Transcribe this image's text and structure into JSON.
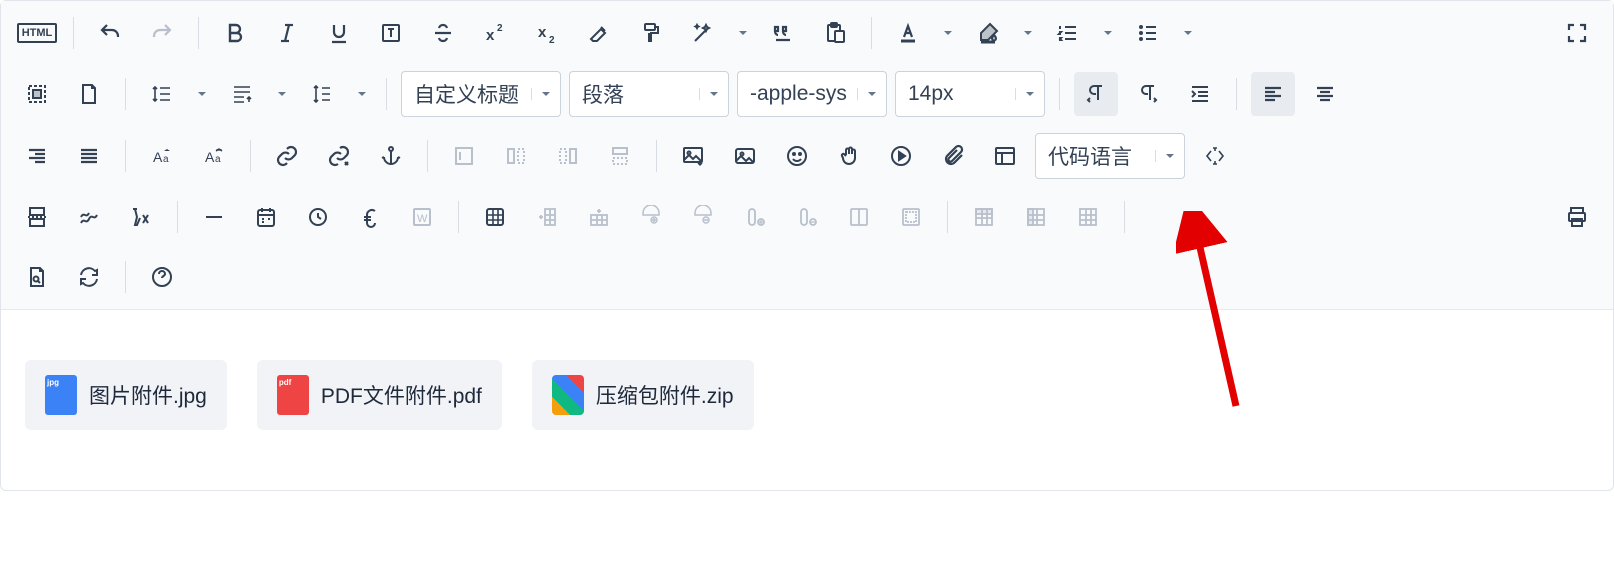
{
  "toolbar": {
    "html_label": "HTML",
    "select_headings": "自定义标题",
    "select_block": "段落",
    "select_font": "-apple-sys",
    "select_size": "14px",
    "select_codelang": "代码语言"
  },
  "attachments": [
    {
      "name": "图片附件.jpg",
      "type": "jpg",
      "ext": "jpg"
    },
    {
      "name": "PDF文件附件.pdf",
      "type": "pdf",
      "ext": "pdf"
    },
    {
      "name": "压缩包附件.zip",
      "type": "zip",
      "ext": ""
    }
  ],
  "icons": {
    "undo": "undo",
    "redo": "redo"
  }
}
